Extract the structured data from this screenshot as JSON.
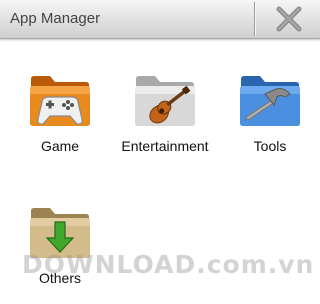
{
  "app_title": "App Manager",
  "header": {
    "close_icon": "close-x-icon"
  },
  "categories": [
    {
      "label": "Game",
      "icon": "gamepad-folder-icon",
      "folder_color": "#e27b14"
    },
    {
      "label": "Entertainment",
      "icon": "guitar-folder-icon",
      "folder_color": "#d6d6d6"
    },
    {
      "label": "Tools",
      "icon": "hammer-folder-icon",
      "folder_color": "#3f86d6"
    },
    {
      "label": "Others",
      "icon": "download-folder-icon",
      "folder_color": "#d2b886"
    }
  ],
  "watermark": "DOWNLOAD.com.vn",
  "colors": {
    "titlebar": "#dcdcdc",
    "title_text": "#444444",
    "background": "#ffffff"
  }
}
